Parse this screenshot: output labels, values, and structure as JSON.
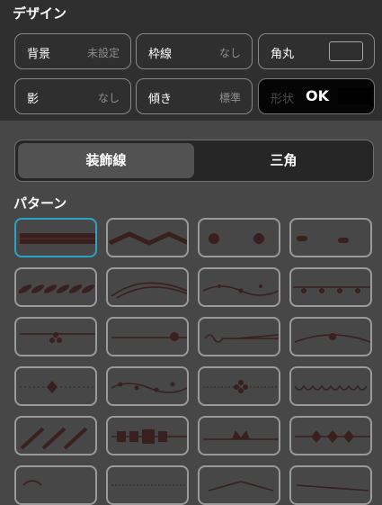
{
  "section_design": {
    "title": "デザイン"
  },
  "props": {
    "background": {
      "label": "背景",
      "value": "未設定"
    },
    "border": {
      "label": "枠線",
      "value": "なし"
    },
    "corner": {
      "label": "角丸"
    },
    "shadow": {
      "label": "影",
      "value": "なし"
    },
    "tilt": {
      "label": "傾き",
      "value": "標準"
    },
    "shape": {
      "label": "形状",
      "ok_label": "OK"
    }
  },
  "tabs": {
    "active": "装飾線",
    "other": "三角"
  },
  "pattern": {
    "title": "パターン",
    "selected_index": 0,
    "tiles": [
      "thick-band-line",
      "zigzag-line",
      "large-dot-pair",
      "dash-pair",
      "braid-leaf-line",
      "swoosh-curve-line",
      "vine-leaf-line",
      "lace-fleur-line",
      "triple-dot-line",
      "center-dot-line",
      "swirl-curl-line",
      "arch-dot-line",
      "diamond-dot-line",
      "leafy-garland-line",
      "flower-center-line",
      "scallop-lace-line",
      "diagonal-slash-line",
      "checker-block-line",
      "crown-ornament-line",
      "triple-diamond-line",
      "partial-row-a",
      "partial-row-b",
      "partial-row-c",
      "partial-row-d"
    ]
  },
  "colors": {
    "selection": "#2aa3c4",
    "ornament": "#3a1f1f",
    "panel_dark": "#2f2f2f",
    "panel_light": "#474747"
  }
}
